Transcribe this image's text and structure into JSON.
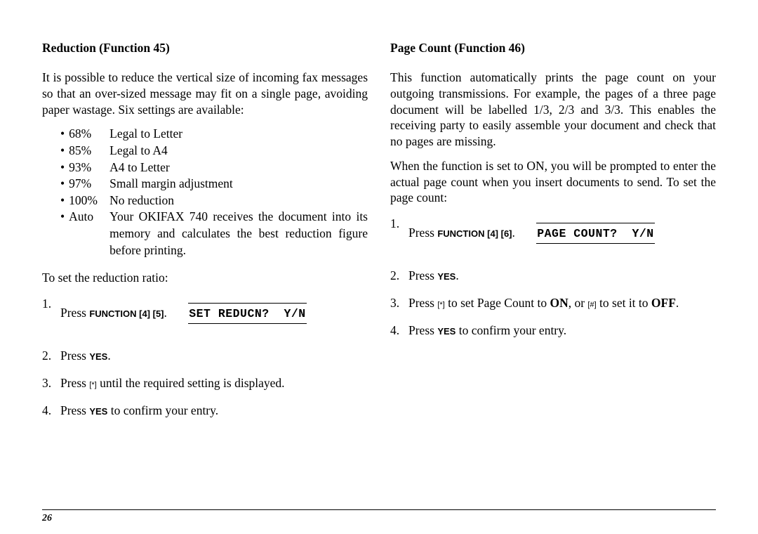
{
  "left": {
    "heading": "Reduction (Function 45)",
    "intro": "It is possible to reduce the vertical size of incoming fax messages so that an over-sized message may fit on a single page, avoiding paper wastage. Six settings are available:",
    "bullets": [
      {
        "pct": "68%",
        "desc": "Legal to Letter"
      },
      {
        "pct": "85%",
        "desc": "Legal to A4"
      },
      {
        "pct": "93%",
        "desc": "A4 to Letter"
      },
      {
        "pct": "97%",
        "desc": "Small margin adjustment"
      },
      {
        "pct": "100%",
        "desc": "No reduction"
      },
      {
        "pct": "Auto",
        "desc": "Your OKIFAX 740 receives the document into its memory and calculates the best reduction figure before printing."
      }
    ],
    "toset": "To set the reduction ratio:",
    "step1_a": "Press ",
    "step1_b": "FUNCTION",
    "step1_c": " [4] [5]",
    "step1_d": ".",
    "display": "SET REDUCN?  Y/N",
    "step2_a": "Press ",
    "step2_b": "YES",
    "step2_c": ".",
    "step3_a": "Press ",
    "step3_b": "[*]",
    "step3_c": " until the required setting is displayed.",
    "step4_a": "Press ",
    "step4_b": "YES",
    "step4_c": " to confirm your entry."
  },
  "right": {
    "heading": "Page Count (Function 46)",
    "intro": "This function automatically prints the page count on your outgoing transmissions. For example, the pages of a three page document will be labelled 1/3, 2/3 and 3/3. This enables the receiving party to easily assemble your document and check that no pages are missing.",
    "para2": "When the function is set to ON, you will be prompted to enter the actual page count when you insert documents to send. To set the page count:",
    "step1_a": "Press ",
    "step1_b": "FUNCTION",
    "step1_c": " [4] [6]",
    "step1_d": ".",
    "display": "PAGE COUNT?  Y/N",
    "step2_a": "Press ",
    "step2_b": "YES",
    "step2_c": ".",
    "step3_a": "Press ",
    "step3_b": "[*]",
    "step3_c": " to set Page Count to ",
    "step3_d": "ON",
    "step3_e": ", or ",
    "step3_f": "[#]",
    "step3_g": " to set it to ",
    "step3_h": "OFF",
    "step3_i": ".",
    "step4_a": "Press ",
    "step4_b": "YES",
    "step4_c": " to confirm your entry."
  },
  "page_number": "26"
}
